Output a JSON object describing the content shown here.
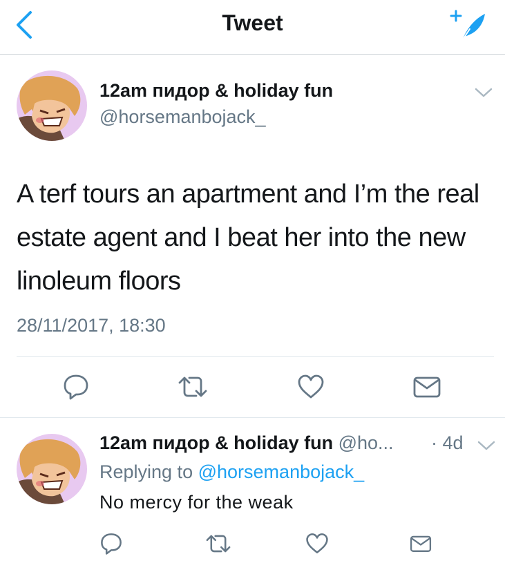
{
  "nav": {
    "title": "Tweet",
    "back_icon": "chevron-left-icon",
    "compose_icon": "compose-feather-icon"
  },
  "colors": {
    "accent": "#1da1f2",
    "text": "#14171a",
    "secondary": "#657786",
    "border": "#e1e8ed"
  },
  "main_tweet": {
    "display_name": "12am пидор & holiday fun",
    "handle": "@horsemanbojack_",
    "text": "A terf tours an apartment and I’m the real estate agent and I beat her into the new linoleum floors",
    "timestamp": "28/11/2017, 18:30",
    "actions": [
      "reply-icon",
      "retweet-icon",
      "like-heart-icon",
      "direct-message-icon"
    ]
  },
  "reply_tweet": {
    "display_name": "12am пидор & holiday fun",
    "handle_truncated": "@ho...",
    "age": "· 4d",
    "replying_prefix": "Replying to",
    "replying_handle": "@horsemanbojack_",
    "text": "No mercy for the weak",
    "actions": [
      "reply-icon",
      "retweet-icon",
      "like-heart-icon",
      "direct-message-icon"
    ]
  }
}
